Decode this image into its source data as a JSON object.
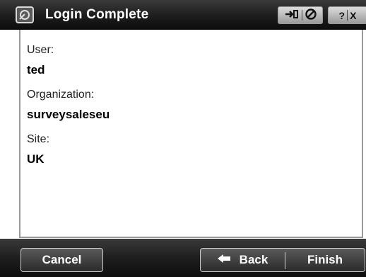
{
  "window": {
    "title": "Login Complete"
  },
  "titlebar_buttons": [
    {
      "icon": "sync-icon"
    },
    {
      "icon": "stop-icon"
    },
    {
      "label": "?"
    },
    {
      "label": "X"
    }
  ],
  "fields": [
    {
      "label": "User:",
      "value": "ted"
    },
    {
      "label": "Organization:",
      "value": "surveysaleseu"
    },
    {
      "label": "Site:",
      "value": "UK"
    }
  ],
  "buttons": {
    "cancel": "Cancel",
    "back": "Back",
    "finish": "Finish"
  },
  "colors": {
    "bar": "#1c1c1c",
    "text_on_bar": "#ffffff"
  }
}
